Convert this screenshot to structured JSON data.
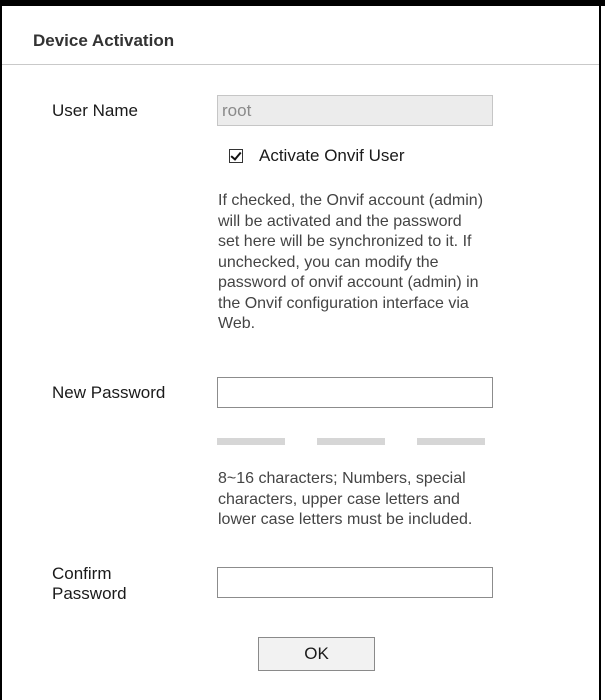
{
  "dialog": {
    "title": "Device Activation"
  },
  "form": {
    "user_name_label": "User Name",
    "user_name_value": "root",
    "onvif_checkbox_label": "Activate Onvif User",
    "onvif_checked": true,
    "onvif_note_lines": [
      "If checked, the Onvif account (admin)",
      "will be activated and the password",
      "set here will be synchronized to it. If",
      "unchecked, you can modify the",
      "password of onvif account (admin) in",
      "the Onvif configuration interface via",
      "Web."
    ],
    "new_password_label": "New Password",
    "new_password_value": "",
    "password_rule_lines": [
      "8~16 characters; Numbers, special",
      "characters, upper case letters and",
      "lower case letters must be included."
    ],
    "confirm_password_label_lines": [
      "Confirm",
      "Password"
    ],
    "confirm_password_value": "",
    "ok_label": "OK"
  }
}
